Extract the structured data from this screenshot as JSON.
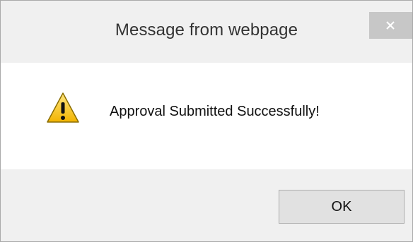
{
  "dialog": {
    "title": "Message from webpage",
    "close_icon": "close-icon",
    "message": "Approval Submitted Successfully!",
    "icon": "warning-icon",
    "ok_label": "OK"
  },
  "colors": {
    "titlebar_bg": "#f0f0f0",
    "content_bg": "#ffffff",
    "close_button_bg": "#c7c7c7",
    "warning_yellow": "#f5c518"
  }
}
